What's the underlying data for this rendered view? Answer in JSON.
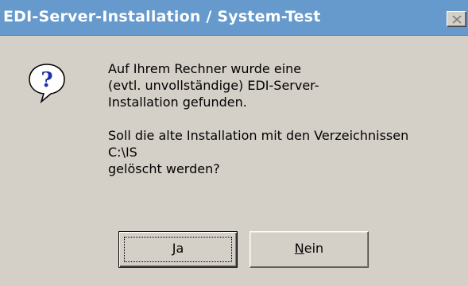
{
  "window": {
    "title": "EDI-Server-Installation / System-Test"
  },
  "icons": {
    "dialog_icon": "question-icon",
    "close": "close-icon"
  },
  "message": {
    "lines_para1": [
      "Auf Ihrem Rechner wurde eine",
      "(evtl. unvollständige) EDI-Server-",
      "Installation gefunden."
    ],
    "lines_para2": [
      "Soll die alte Installation mit den Verzeichnissen",
      "C:\\IS",
      "gelöscht werden?"
    ]
  },
  "buttons": {
    "yes": {
      "mnemonic": "J",
      "rest": "a"
    },
    "no": {
      "mnemonic": "N",
      "rest": "ein"
    }
  },
  "colors": {
    "titlebar": "#6699cc",
    "face": "#d4d0c8",
    "icon_blue": "#1f2fa8"
  }
}
